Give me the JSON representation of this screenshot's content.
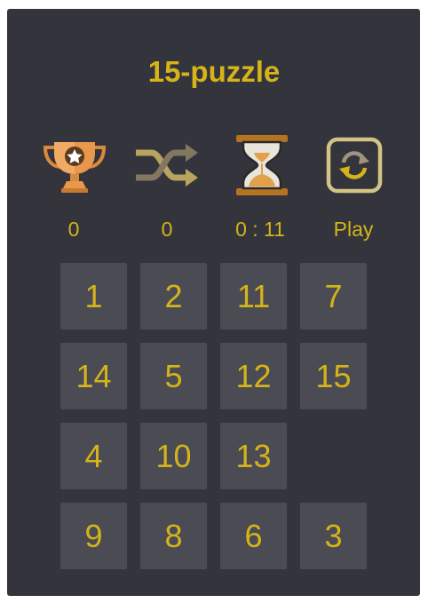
{
  "title": "15-puzzle",
  "stats": {
    "best": "0",
    "moves": "0",
    "time": "0 : 11",
    "action": "Play"
  },
  "icons": {
    "best": "trophy-icon",
    "moves": "shuffle-icon",
    "time": "hourglass-icon",
    "action": "refresh-icon"
  },
  "board": [
    "1",
    "2",
    "11",
    "7",
    "14",
    "5",
    "12",
    "15",
    "4",
    "10",
    "13",
    "",
    "9",
    "8",
    "6",
    "3"
  ],
  "colors": {
    "panel": "#34343c",
    "tile": "#4b4b54",
    "text": "#d4b419"
  }
}
